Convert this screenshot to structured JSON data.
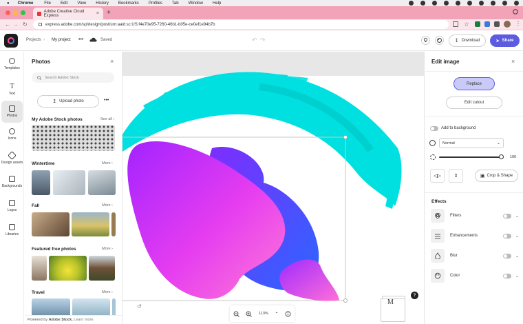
{
  "menubar": {
    "app": "Chrome",
    "items": [
      "File",
      "Edit",
      "View",
      "History",
      "Bookmarks",
      "Profiles",
      "Tab",
      "Window",
      "Help"
    ]
  },
  "browser": {
    "tab_title": "Adobe Creative Cloud Express",
    "url": "express.adobe.com/sp/design/post/urn:aaid:sc:US:f4e70e95-7260-46b1-b05e-ce0ef1e94b7b"
  },
  "header": {
    "breadcrumb_projects": "Projects",
    "project_name": "My project",
    "more": "•••",
    "saved": "Saved",
    "download": "Download",
    "share": "Share"
  },
  "rail": {
    "items": [
      "Templates",
      "Text",
      "Photos",
      "Icons",
      "Design assets",
      "Backgrounds",
      "Logos",
      "Libraries"
    ],
    "active": "Photos"
  },
  "panel": {
    "title": "Photos",
    "search_placeholder": "Search Adobe Stock",
    "upload": "Upload photo",
    "more": "•••",
    "sections": [
      {
        "title": "My Adobe Stock photos",
        "link": "See all ›"
      },
      {
        "title": "Wintertime",
        "link": "More ›"
      },
      {
        "title": "Fall",
        "link": "More ›"
      },
      {
        "title": "Featured free photos",
        "link": "More ›"
      },
      {
        "title": "Travel",
        "link": "More ›"
      }
    ],
    "footer_prefix": "Powered by ",
    "footer_brand": "Adobe Stock.",
    "footer_link": "Learn more."
  },
  "canvas": {
    "zoom": "113%",
    "help": "?"
  },
  "edit": {
    "title": "Edit image",
    "replace": "Replace",
    "edit_cutout": "Edit cutout",
    "add_background": "Add to background",
    "blend_mode": "Normal",
    "opacity": "100",
    "crop_shape": "Crop & Shape",
    "effects_title": "Effects",
    "effects": [
      "Filters",
      "Enhancements",
      "Blur",
      "Color"
    ]
  },
  "colors": {
    "accent": "#5c5ce0",
    "replace_bg": "#c9caf7",
    "brush": "#00e0e0",
    "tab_strip": "#f3a3b8"
  }
}
